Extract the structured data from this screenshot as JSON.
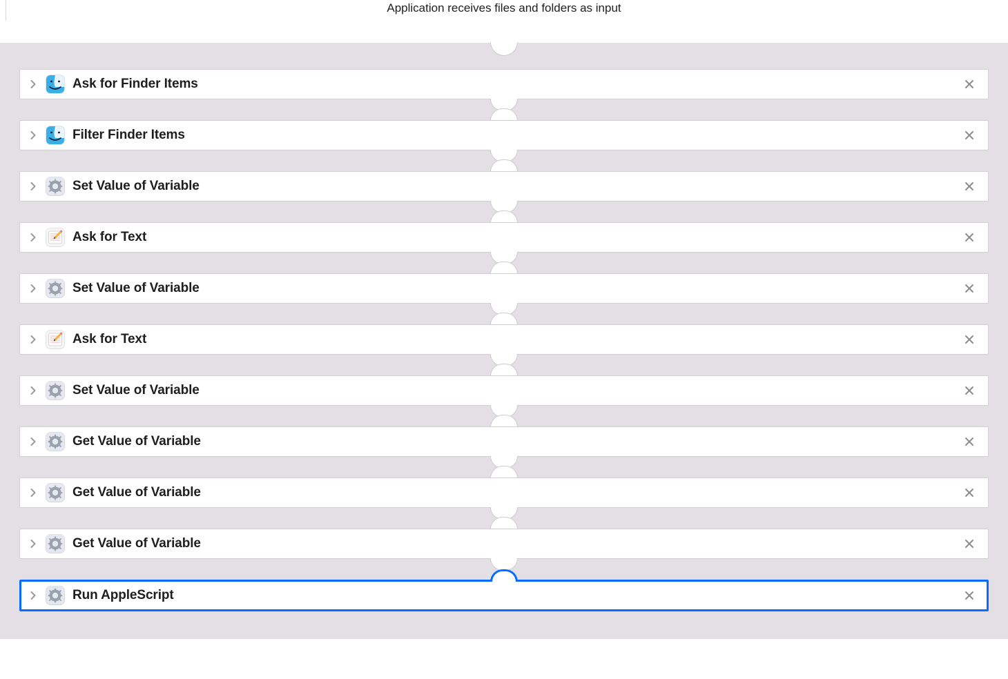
{
  "header_text": "Application receives files and folders as input",
  "actions": [
    {
      "title": "Ask for Finder Items",
      "icon": "finder",
      "selected": false
    },
    {
      "title": "Filter Finder Items",
      "icon": "finder",
      "selected": false
    },
    {
      "title": "Set Value of Variable",
      "icon": "automator",
      "selected": false
    },
    {
      "title": "Ask for Text",
      "icon": "texteditor",
      "selected": false
    },
    {
      "title": "Set Value of Variable",
      "icon": "automator",
      "selected": false
    },
    {
      "title": "Ask for Text",
      "icon": "texteditor",
      "selected": false
    },
    {
      "title": "Set Value of Variable",
      "icon": "automator",
      "selected": false
    },
    {
      "title": "Get Value of Variable",
      "icon": "automator",
      "selected": false
    },
    {
      "title": "Get Value of Variable",
      "icon": "automator",
      "selected": false
    },
    {
      "title": "Get Value of Variable",
      "icon": "automator",
      "selected": false
    },
    {
      "title": "Run AppleScript",
      "icon": "automator",
      "selected": true
    }
  ]
}
